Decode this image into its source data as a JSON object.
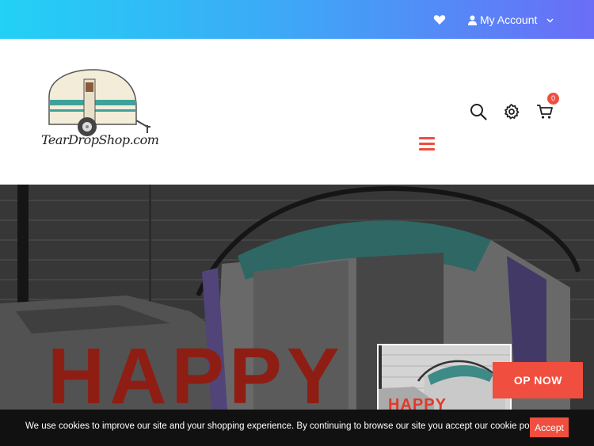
{
  "topbar": {
    "account_label": "My Account"
  },
  "header": {
    "logo_text": "TearDropShop.com",
    "cart_count": "0"
  },
  "hero": {
    "title": "HAPPY",
    "shop_button": "OP NOW",
    "thumb_title": "HAPPY"
  },
  "cookie": {
    "message": "We use cookies to improve our site and your shopping experience. By continuing to browse our site you accept our cookie policy.",
    "accept_label": "Accept"
  },
  "colors": {
    "accent": "#f04e3e",
    "gradient_start": "#22d1f5",
    "gradient_end": "#6a6df7",
    "cookie_bg": "#111111"
  },
  "icons": [
    "heart-icon",
    "user-icon",
    "chevron-down-icon",
    "search-icon",
    "gear-icon",
    "cart-icon",
    "hamburger-menu-icon"
  ]
}
